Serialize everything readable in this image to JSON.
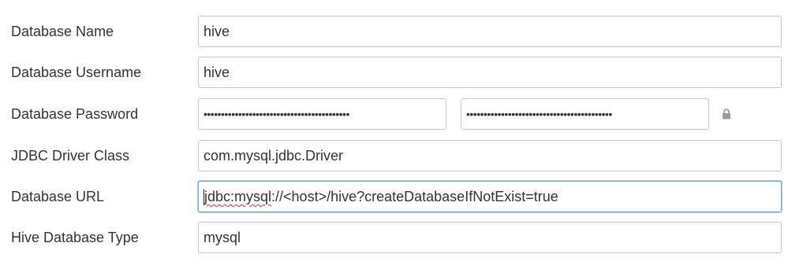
{
  "form": {
    "rows": [
      {
        "label": "Database Name",
        "value": "hive"
      },
      {
        "label": "Database Username",
        "value": "hive"
      },
      {
        "label": "Database Password",
        "value": "••••••••••••••••••••••••••••••••••••••••••",
        "confirm_value": "••••••••••••••••••••••••••••••••••••••••••",
        "icon": "lock-icon"
      },
      {
        "label": "JDBC Driver Class",
        "value": "com.mysql.jdbc.Driver"
      },
      {
        "label": "Database URL",
        "value_prefix": "jdbc:mysql",
        "value_rest": "://<host>/hive?createDatabaseIfNotExist=true"
      },
      {
        "label": "Hive Database Type",
        "value": "mysql"
      }
    ]
  },
  "colors": {
    "focus_border": "#6fa8dc",
    "field_border": "#c8c8c8",
    "spellcheck_underline": "#e03030"
  }
}
